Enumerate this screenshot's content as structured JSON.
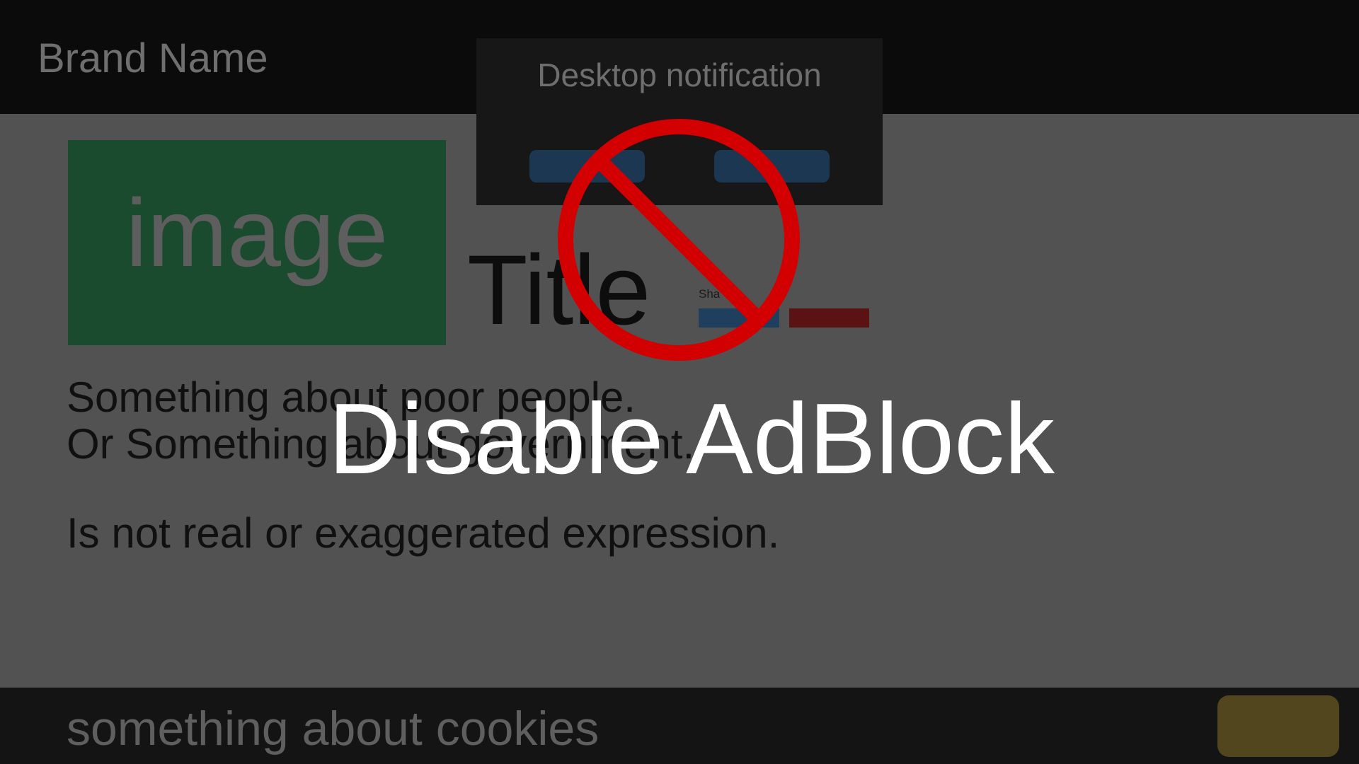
{
  "header": {
    "brand": "Brand Name"
  },
  "article": {
    "image_label": "image",
    "title": "Title",
    "share_label": "Sha",
    "lines": [
      "Something about poor people.",
      "Or Something about government.",
      "Is not real or exaggerated expression."
    ]
  },
  "notification": {
    "title": "Desktop notification"
  },
  "overlay": {
    "message": "Disable AdBlock",
    "icon": "no-symbol-icon",
    "icon_color": "#d20000"
  },
  "cookie_bar": {
    "text": "something about cookies"
  },
  "colors": {
    "page_background": "#525252",
    "header_background": "#0b0b0b",
    "image_placeholder": "#1b4b2f",
    "share_blue": "#1e3f5e",
    "share_red": "#5a1213",
    "cookie_button": "#51461d"
  }
}
